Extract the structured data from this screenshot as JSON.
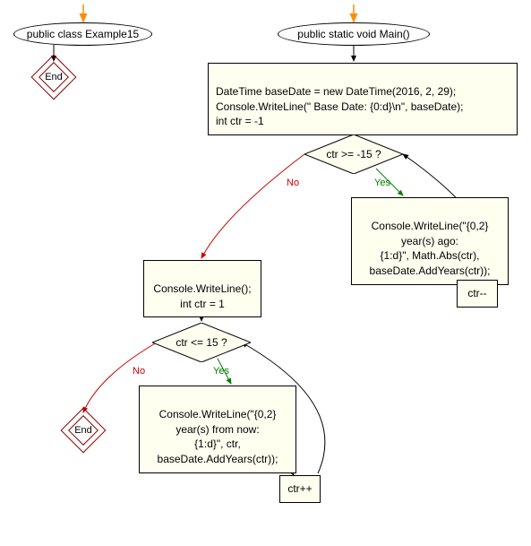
{
  "left_cluster": {
    "ellipse_label": "public class Example15",
    "end_label": "End"
  },
  "right_cluster": {
    "ellipse_label": "public static void Main()",
    "init_block": "DateTime baseDate = new DateTime(2016, 2, 29);\nConsole.WriteLine(\"    Base Date:       {0:d}\\n\", baseDate);\nint ctr = -1",
    "cond1": "ctr >= -15 ?",
    "cond1_no": "No",
    "cond1_yes": "Yes",
    "loop1_body": "Console.WriteLine(\"{0,2}\nyear(s) ago:\n{1:d}\", Math.Abs(ctr),\nbaseDate.AddYears(ctr));",
    "loop1_step": "ctr--",
    "mid_block": "Console.WriteLine();\nint ctr = 1",
    "cond2": "ctr <= 15 ?",
    "cond2_no": "No",
    "cond2_yes": "Yes",
    "loop2_body": "Console.WriteLine(\"{0,2}\nyear(s) from now:\n{1:d}\", ctr,\nbaseDate.AddYears(ctr));",
    "loop2_step": "ctr++",
    "end_label": "End"
  },
  "colors": {
    "bg_node": "#fffff0",
    "border": "#000000",
    "end_border": "#8b0000",
    "no_color": "#cc0000",
    "yes_color": "#008000",
    "arrow_orange": "#ff8c00"
  }
}
